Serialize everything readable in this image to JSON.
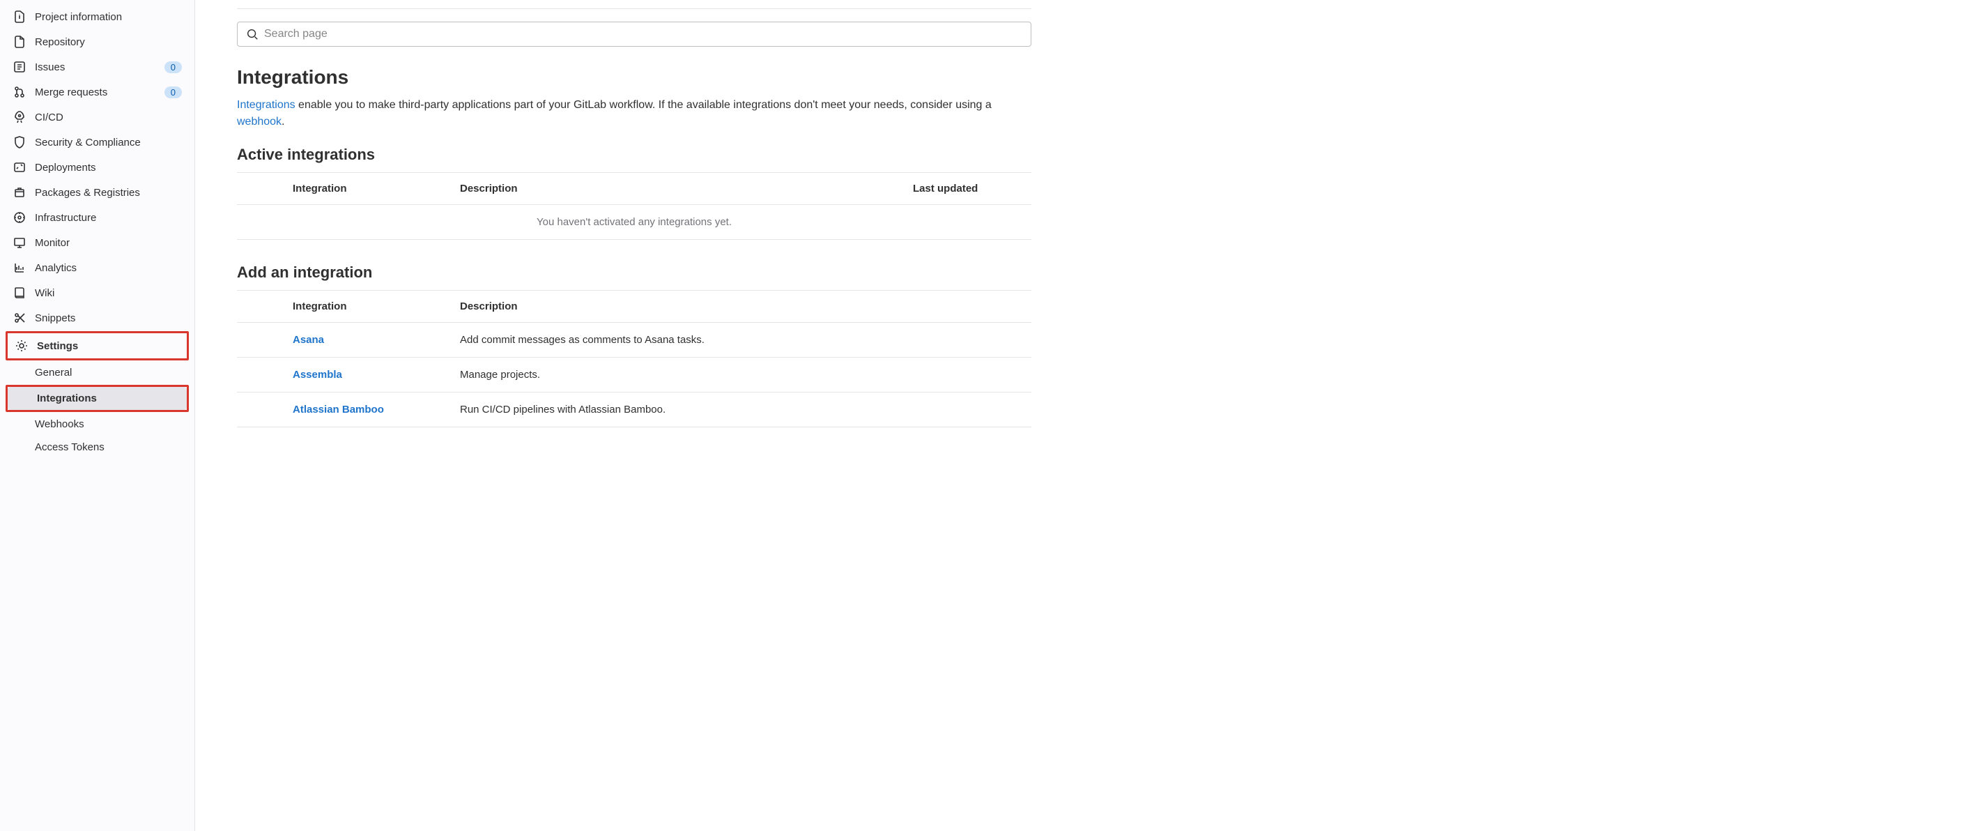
{
  "sidebar": {
    "items": [
      {
        "label": "Project information"
      },
      {
        "label": "Repository"
      },
      {
        "label": "Issues",
        "badge": "0"
      },
      {
        "label": "Merge requests",
        "badge": "0"
      },
      {
        "label": "CI/CD"
      },
      {
        "label": "Security & Compliance"
      },
      {
        "label": "Deployments"
      },
      {
        "label": "Packages & Registries"
      },
      {
        "label": "Infrastructure"
      },
      {
        "label": "Monitor"
      },
      {
        "label": "Analytics"
      },
      {
        "label": "Wiki"
      },
      {
        "label": "Snippets"
      },
      {
        "label": "Settings"
      }
    ],
    "sub": [
      {
        "label": "General"
      },
      {
        "label": "Integrations"
      },
      {
        "label": "Webhooks"
      },
      {
        "label": "Access Tokens"
      }
    ]
  },
  "search": {
    "placeholder": "Search page"
  },
  "page": {
    "title": "Integrations",
    "intro_link1": "Integrations",
    "intro_text1": " enable you to make third-party applications part of your GitLab workflow. If the available integrations don't meet your needs, consider using a ",
    "intro_link2": "webhook",
    "intro_text2": "."
  },
  "active": {
    "title": "Active integrations",
    "headers": {
      "integration": "Integration",
      "description": "Description",
      "last_updated": "Last updated"
    },
    "empty": "You haven't activated any integrations yet."
  },
  "add": {
    "title": "Add an integration",
    "headers": {
      "integration": "Integration",
      "description": "Description"
    },
    "rows": [
      {
        "name": "Asana",
        "desc": "Add commit messages as comments to Asana tasks."
      },
      {
        "name": "Assembla",
        "desc": "Manage projects."
      },
      {
        "name": "Atlassian Bamboo",
        "desc": "Run CI/CD pipelines with Atlassian Bamboo."
      }
    ]
  }
}
